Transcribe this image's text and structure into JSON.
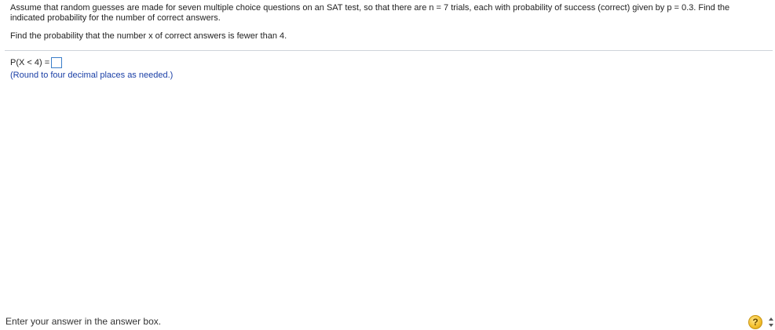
{
  "question": {
    "problem_text": "Assume that random guesses are made for seven multiple choice questions on an SAT test, so that there are n = 7 trials, each with probability of success (correct) given by p = 0.3. Find the indicated probability for the number of correct answers.",
    "instruction_text": "Find the probability that the number x of correct answers is fewer than 4."
  },
  "answer": {
    "label": "P(X < 4) =",
    "value": "",
    "hint": "(Round to four decimal places as needed.)"
  },
  "footer": {
    "status": "Enter your answer in the answer box.",
    "help_symbol": "?"
  }
}
